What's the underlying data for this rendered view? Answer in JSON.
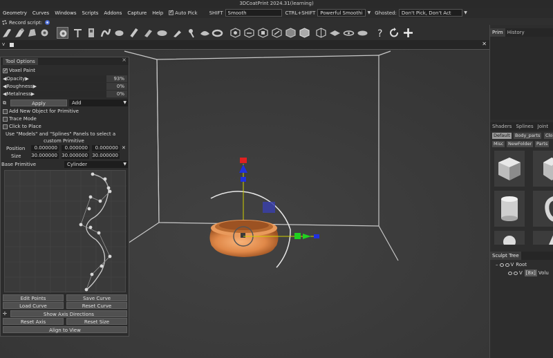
{
  "window": {
    "title": "3DCoatPrint 2024.31(learning)"
  },
  "menubar": {
    "items": [
      "Geometry",
      "Curves",
      "Windows",
      "Scripts",
      "Addons",
      "Capture",
      "Help"
    ],
    "auto_pick_label": "Auto Pick",
    "shift_label": "SHIFT",
    "shift_value": "Smooth",
    "ctrl_shift_label": "CTRL+SHIFT",
    "ctrl_shift_value": "Powerful Smoothi",
    "ghosted_label": "Ghosted:",
    "ghosted_value": "Don't Pick, Don't Act"
  },
  "toolbar": {
    "record_script_label": "Record script:",
    "icons": [
      "clay-icon",
      "clay-buildup-icon",
      "cloth-icon",
      "pose-gear-icon",
      "primitives-icon",
      "text-icon",
      "letters-icon",
      "snake-icon",
      "fill-icon",
      "tube-icon",
      "strips-icon",
      "extrude-icon",
      "grow-icon",
      "flatten-icon",
      "smooth-icon",
      "cube-select-icon",
      "cube-draw-icon",
      "cube-move-icon",
      "cube-scale-icon",
      "cube-cut-icon",
      "cube-fill-icon",
      "cube-brush-icon",
      "plane-icon",
      "snap-plane-icon",
      "ring-icon",
      "help-icon",
      "undo-icon",
      "add-icon"
    ]
  },
  "tool_panel": {
    "tab_label": "Tool Options",
    "voxel_paint_label": "Voxel Paint",
    "opacity_label": "Opacity",
    "opacity_value": "93%",
    "roughness_label": "Roughness",
    "roughness_value": "0%",
    "metalness_label": "Metalness",
    "metalness_value": "0%",
    "apply_label": "Apply",
    "mode_value": "Add",
    "add_new_object_label": "Add New Object for Primitive",
    "trace_mode_label": "Trace Mode",
    "click_to_place_label": "Click to Place",
    "hint_line1": "Use \"Models\" and \"Splines\" Panels to select a",
    "hint_line2": "custom Primitive",
    "position_label": "Position",
    "position_values": [
      "0.000000",
      "0.000000",
      "0.000000"
    ],
    "size_label": "Size",
    "size_values": [
      "30.000000",
      "30.000000",
      "30.000000"
    ],
    "base_primitive_label": "Base Primitive",
    "base_primitive_value": "Cylinder",
    "edit_points_label": "Edit Points",
    "save_curve_label": "Save Curve",
    "load_curve_label": "Load Curve",
    "reset_curve_label": "Reset Curve",
    "show_axis_label": "Show Axis Directions",
    "reset_axis_label": "Reset Axis",
    "reset_size_label": "Reset Size",
    "align_view_label": "Align to View"
  },
  "right_panel": {
    "top_tabs": [
      "Prim",
      "History"
    ],
    "shader_tabs": [
      "Shaders",
      "Splines",
      "Joint"
    ],
    "chips_row1": [
      "Default",
      "Body_parts",
      "Clo"
    ],
    "chips_row2": [
      "Misc",
      "NewFolder",
      "Parts"
    ],
    "sculpt_tree_label": "Sculpt Tree",
    "root_label": "Root",
    "volume_tag": "[8x]",
    "volume_label": "Volu"
  },
  "colors": {
    "accent_blue": "#4a6ad0",
    "pot_orange": "#e08848",
    "gizmo_red": "#e02020",
    "gizmo_green": "#20d020",
    "gizmo_blue": "#2030e0"
  }
}
